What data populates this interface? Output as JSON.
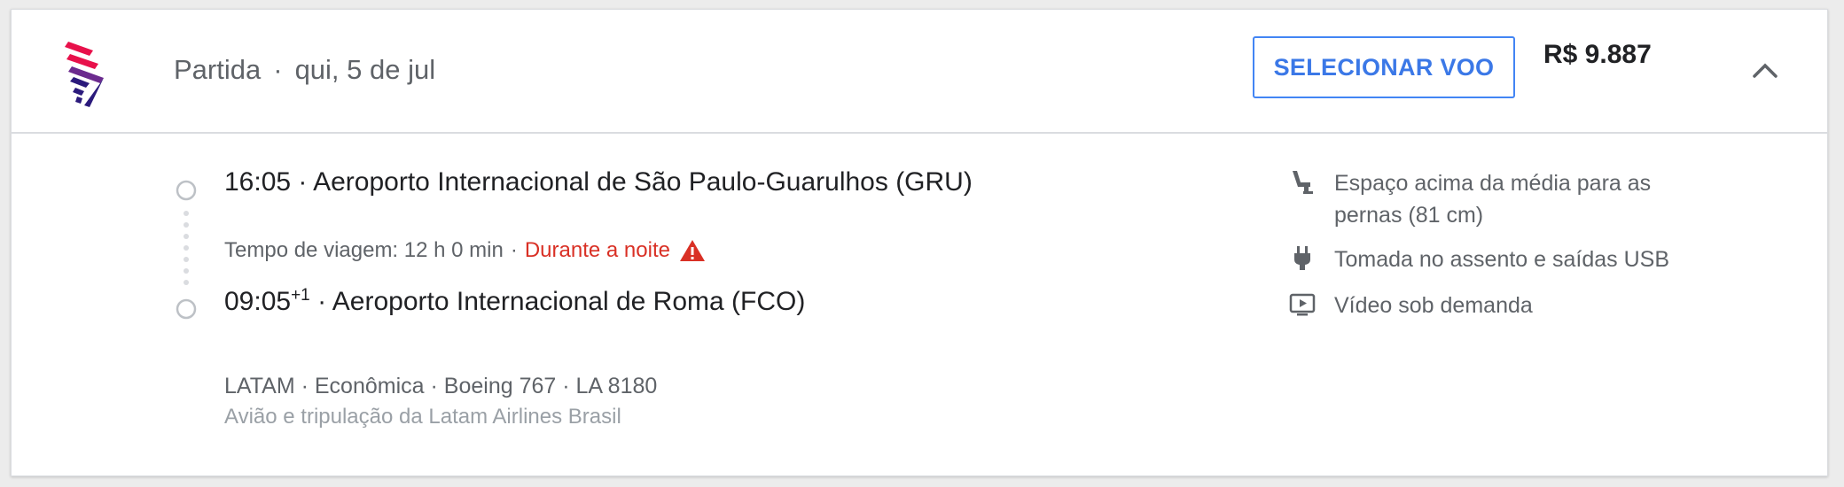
{
  "header": {
    "departure_label": "Partida",
    "separator": "·",
    "date": "qui, 5 de jul",
    "select_button_label": "SELECIONAR VOO",
    "price": "R$ 9.887"
  },
  "itinerary": {
    "departure": {
      "time": "16:05",
      "airport": "Aeroporto Internacional de São Paulo-Guarulhos (GRU)"
    },
    "duration_text": "Tempo de viagem: 12 h 0 min",
    "overnight_label": "Durante a noite",
    "arrival": {
      "time": "09:05",
      "day_offset": "+1",
      "airport": "Aeroporto Internacional de Roma (FCO)"
    },
    "flight_details": {
      "airline": "LATAM",
      "cabin": "Econômica",
      "aircraft": "Boeing 767",
      "flight_number": "LA 8180"
    },
    "operator": "Avião e tripulação da Latam Airlines Brasil"
  },
  "amenities": [
    {
      "icon": "legroom-seat-icon",
      "text": "Espaço acima da média para as pernas (81 cm)"
    },
    {
      "icon": "power-plug-icon",
      "text": "Tomada no assento e saídas USB"
    },
    {
      "icon": "video-play-icon",
      "text": "Vídeo sob demanda"
    }
  ],
  "colors": {
    "accent_blue": "#4285f4",
    "warning_red": "#d93025",
    "logo_magenta": "#e8114b",
    "logo_indigo": "#2b1a7c"
  }
}
